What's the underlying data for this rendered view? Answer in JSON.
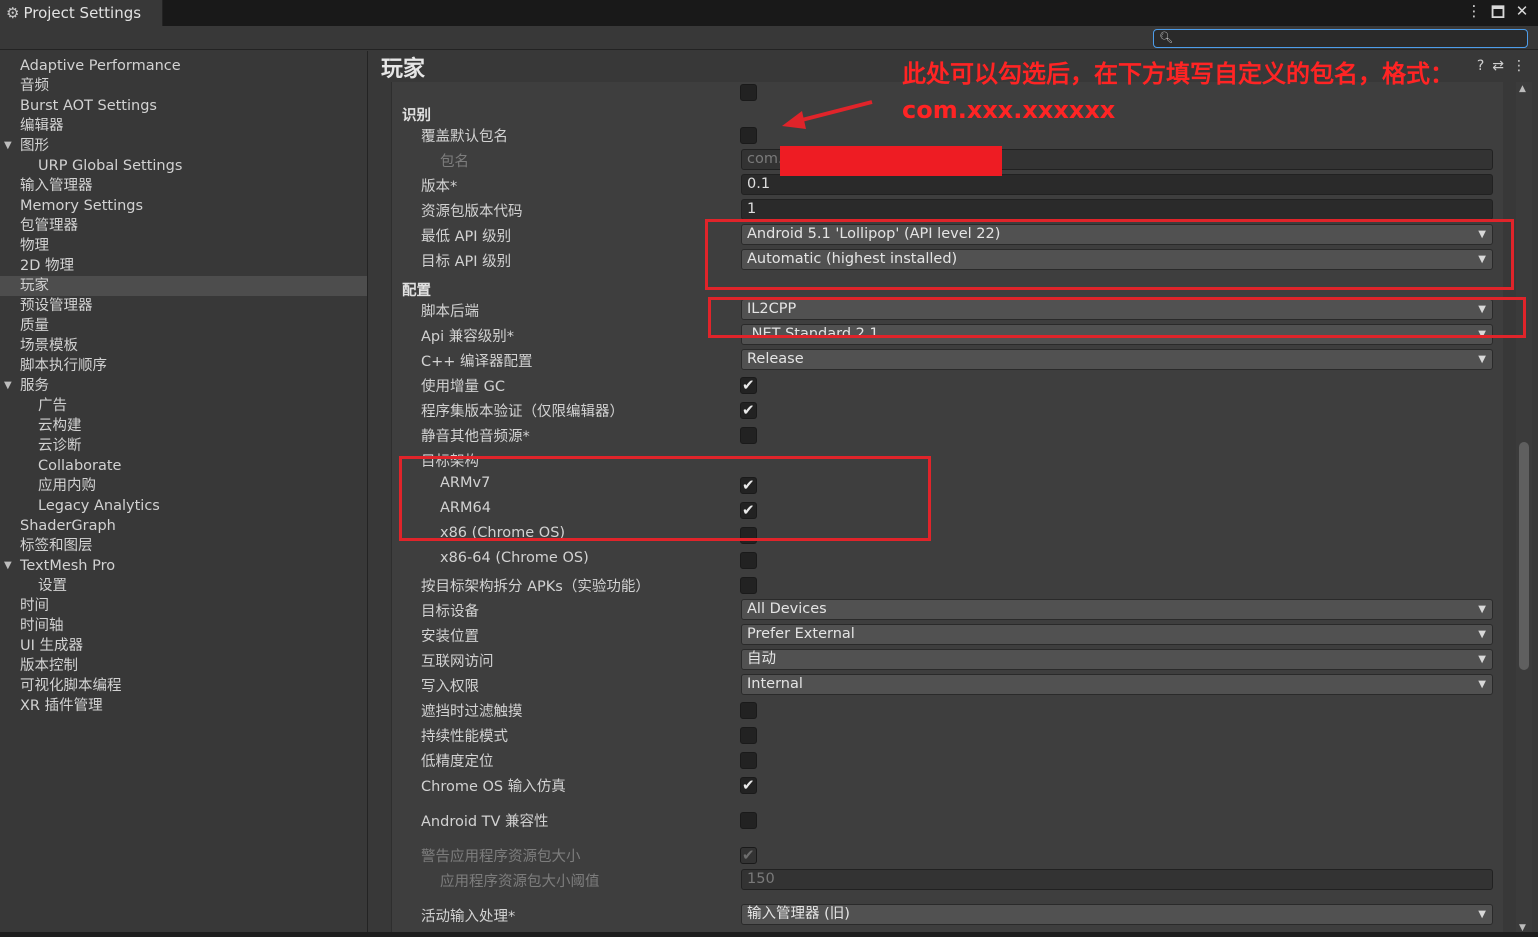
{
  "window": {
    "title": "Project Settings",
    "icons": [
      "gear-icon",
      "more-vert-icon",
      "maximize-icon",
      "close-icon"
    ]
  },
  "search": {
    "value": "",
    "placeholder": ""
  },
  "sidebar": {
    "items": [
      {
        "label": "Adaptive Performance",
        "indent": 0
      },
      {
        "label": "音频",
        "indent": 0
      },
      {
        "label": "Burst AOT Settings",
        "indent": 0
      },
      {
        "label": "编辑器",
        "indent": 0
      },
      {
        "label": "图形",
        "indent": 0,
        "expanded": true
      },
      {
        "label": "URP Global Settings",
        "indent": 1
      },
      {
        "label": "输入管理器",
        "indent": 0
      },
      {
        "label": "Memory Settings",
        "indent": 0
      },
      {
        "label": "包管理器",
        "indent": 0
      },
      {
        "label": "物理",
        "indent": 0
      },
      {
        "label": "2D 物理",
        "indent": 0
      },
      {
        "label": "玩家",
        "indent": 0,
        "selected": true
      },
      {
        "label": "预设管理器",
        "indent": 0
      },
      {
        "label": "质量",
        "indent": 0
      },
      {
        "label": "场景模板",
        "indent": 0
      },
      {
        "label": "脚本执行顺序",
        "indent": 0
      },
      {
        "label": "服务",
        "indent": 0,
        "expanded": true
      },
      {
        "label": "广告",
        "indent": 1
      },
      {
        "label": "云构建",
        "indent": 1
      },
      {
        "label": "云诊断",
        "indent": 1
      },
      {
        "label": "Collaborate",
        "indent": 1
      },
      {
        "label": "应用内购",
        "indent": 1
      },
      {
        "label": "Legacy Analytics",
        "indent": 1
      },
      {
        "label": "ShaderGraph",
        "indent": 0
      },
      {
        "label": "标签和图层",
        "indent": 0
      },
      {
        "label": "TextMesh Pro",
        "indent": 0,
        "expanded": true
      },
      {
        "label": "设置",
        "indent": 1
      },
      {
        "label": "时间",
        "indent": 0
      },
      {
        "label": "时间轴",
        "indent": 0
      },
      {
        "label": "UI 生成器",
        "indent": 0
      },
      {
        "label": "版本控制",
        "indent": 0
      },
      {
        "label": "可视化脚本编程",
        "indent": 0
      },
      {
        "label": "XR 插件管理",
        "indent": 0
      }
    ]
  },
  "main": {
    "title": "玩家",
    "header_icons": [
      "help-icon",
      "preset-icon",
      "more-vert-icon"
    ],
    "rows": [
      {
        "type": "check",
        "label": "",
        "checked": false,
        "partial": true
      },
      {
        "type": "header",
        "label": "识别"
      },
      {
        "type": "check",
        "label": "覆盖默认包名",
        "checked": false
      },
      {
        "type": "text",
        "label": "包名",
        "value": "com.",
        "sub": true,
        "disabled": true
      },
      {
        "type": "text",
        "label": "版本*",
        "value": "0.1"
      },
      {
        "type": "text",
        "label": "资源包版本代码",
        "value": "1"
      },
      {
        "type": "dropdown",
        "label": "最低 API 级别",
        "value": "Android 5.1 'Lollipop' (API level 22)"
      },
      {
        "type": "dropdown",
        "label": "目标 API 级别",
        "value": "Automatic (highest installed)"
      },
      {
        "type": "header",
        "label": "配置"
      },
      {
        "type": "dropdown",
        "label": "脚本后端",
        "value": "IL2CPP"
      },
      {
        "type": "dropdown",
        "label": "Api 兼容级别*",
        "value": ".NET Standard 2.1"
      },
      {
        "type": "dropdown",
        "label": "C++ 编译器配置",
        "value": "Release"
      },
      {
        "type": "check",
        "label": "使用增量 GC",
        "checked": true
      },
      {
        "type": "check",
        "label": "程序集版本验证（仅限编辑器）",
        "checked": true
      },
      {
        "type": "check",
        "label": "静音其他音频源*",
        "checked": false
      },
      {
        "type": "label",
        "label": "目标架构"
      },
      {
        "type": "check",
        "label": "ARMv7",
        "checked": true,
        "sub": true
      },
      {
        "type": "check",
        "label": "ARM64",
        "checked": true,
        "sub": true
      },
      {
        "type": "check",
        "label": "x86 (Chrome OS)",
        "checked": false,
        "sub": true
      },
      {
        "type": "check",
        "label": "x86-64 (Chrome OS)",
        "checked": false,
        "sub": true
      },
      {
        "type": "check",
        "label": "按目标架构拆分 APKs（实验功能）",
        "checked": false
      },
      {
        "type": "dropdown",
        "label": "目标设备",
        "value": "All Devices"
      },
      {
        "type": "dropdown",
        "label": "安装位置",
        "value": "Prefer External"
      },
      {
        "type": "dropdown",
        "label": "互联网访问",
        "value": "自动"
      },
      {
        "type": "dropdown",
        "label": "写入权限",
        "value": "Internal"
      },
      {
        "type": "check",
        "label": "遮挡时过滤触摸",
        "checked": false
      },
      {
        "type": "check",
        "label": "持续性能模式",
        "checked": false
      },
      {
        "type": "check",
        "label": "低精度定位",
        "checked": false
      },
      {
        "type": "check",
        "label": "Chrome OS 输入仿真",
        "checked": true
      },
      {
        "type": "check",
        "label": "Android TV 兼容性",
        "checked": false,
        "gap": 10
      },
      {
        "type": "check",
        "label": "警告应用程序资源包大小",
        "checked": true,
        "disabled": true,
        "gap": 10
      },
      {
        "type": "text",
        "label": "应用程序资源包大小阈值",
        "value": "150",
        "sub": true,
        "disabled": true
      },
      {
        "type": "dropdown",
        "label": "活动输入处理*",
        "value": "输入管理器 (旧)",
        "gap": 10
      }
    ]
  },
  "annotations": {
    "line1": "此处可以勾选后，在下方填写自定义的包名，格式：",
    "line2": "com.xxx.xxxxxx",
    "color": "#e0242a"
  }
}
